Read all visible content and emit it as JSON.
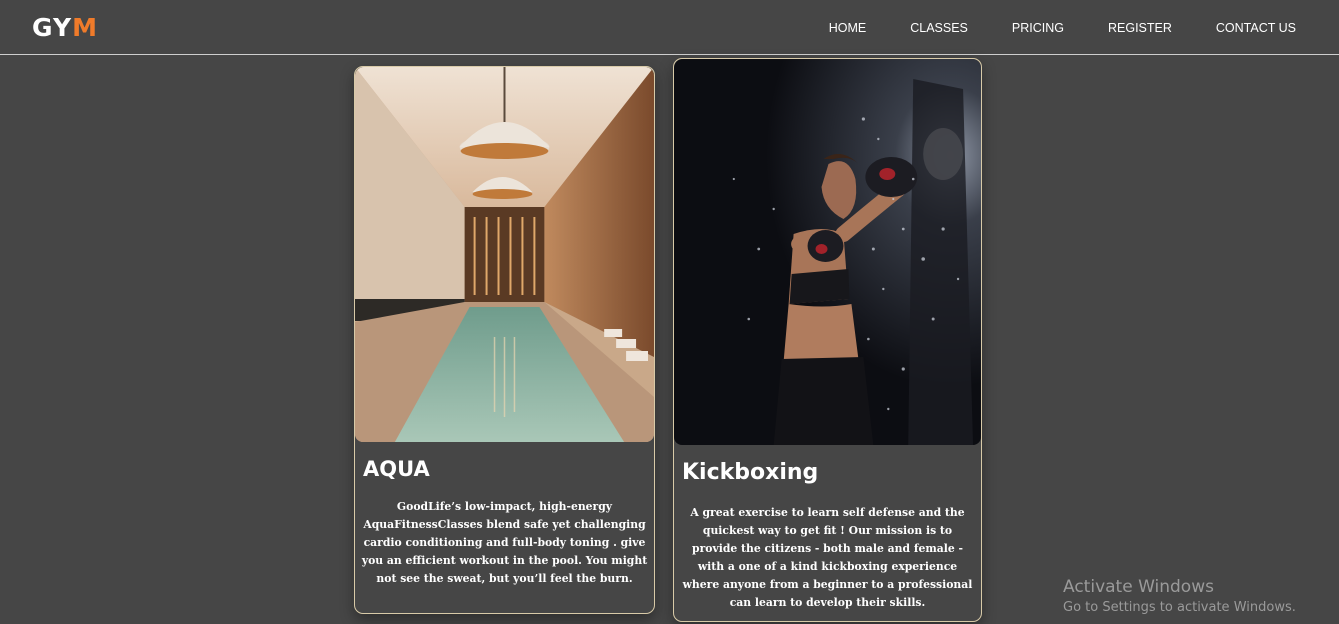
{
  "brand": {
    "logo_part1": "GY",
    "logo_part2": "M",
    "accent_color": "#f07b2a"
  },
  "nav": {
    "items": [
      {
        "label": "HOME"
      },
      {
        "label": "CLASSES"
      },
      {
        "label": "PRICING"
      },
      {
        "label": "REGISTER"
      },
      {
        "label": "CONTACT US"
      }
    ]
  },
  "cards": [
    {
      "title": "AQUA",
      "image": "indoor-pool-photo",
      "text": "GoodLife’s low-impact, high-energy AquaFitnessClasses blend safe yet challenging cardio conditioning and full-body toning . give you an efficient workout in the pool. You might not see the sweat, but you’ll feel the burn."
    },
    {
      "title": "Kickboxing",
      "image": "kickboxing-punching-bag-photo",
      "text": "A great exercise to learn self defense and the quickest way to get fit ! Our mission is to provide the citizens - both male and female - with a one of a kind kickboxing experience where anyone from a beginner to a professional can learn to develop their skills."
    }
  ],
  "watermark": {
    "line1": "Activate Windows",
    "line2": "Go to Settings to activate Windows."
  }
}
